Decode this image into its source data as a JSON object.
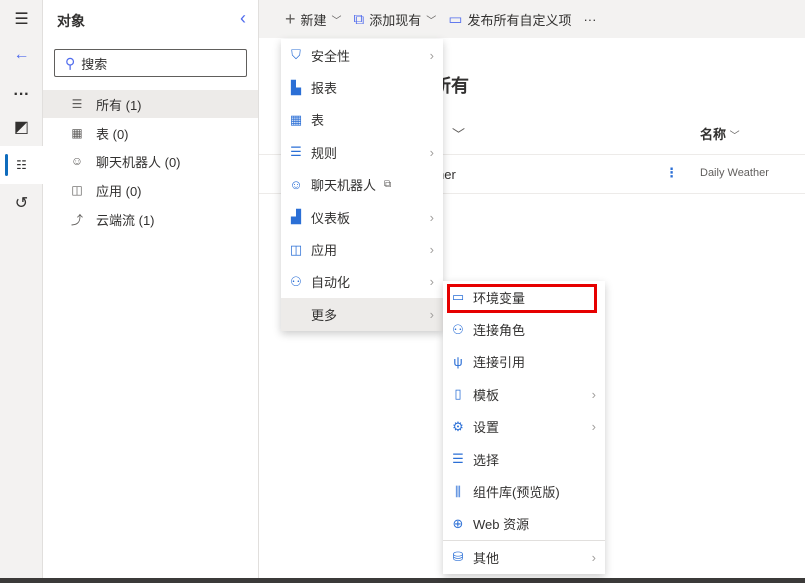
{
  "rail": {
    "icons": [
      "hamburger-icon",
      "back-arrow-icon",
      "more-icon",
      "solution-icon",
      "objects-icon",
      "history-icon"
    ]
  },
  "panel": {
    "title": "对象",
    "search_placeholder": "搜索",
    "items": [
      {
        "label": "所有 (1)",
        "icon": "list-icon"
      },
      {
        "label": "表 (0)",
        "icon": "table-icon"
      },
      {
        "label": "聊天机器人 (0)",
        "icon": "bot-icon"
      },
      {
        "label": "应用 (0)",
        "icon": "app-icon"
      },
      {
        "label": "云端流 (1)",
        "icon": "flow-icon"
      }
    ]
  },
  "toolbar": {
    "new": "新建",
    "add_existing": "添加现有",
    "publish": "发布所有自定义项",
    "more": "···"
  },
  "main": {
    "title": "所有",
    "col_name": "名称",
    "row_partial": "her",
    "row_name": "Daily Weather"
  },
  "menu_new": [
    {
      "label": "安全性",
      "icon": "shield-icon",
      "sub": true
    },
    {
      "label": "报表",
      "icon": "report-icon"
    },
    {
      "label": "表",
      "icon": "table-icon"
    },
    {
      "label": "规则",
      "icon": "rules-icon",
      "sub": true
    },
    {
      "label": "聊天机器人",
      "icon": "bot-icon",
      "external": true
    },
    {
      "label": "仪表板",
      "icon": "dashboard-icon",
      "sub": true
    },
    {
      "label": "应用",
      "icon": "app-icon",
      "sub": true
    },
    {
      "label": "自动化",
      "icon": "automation-icon",
      "sub": true
    },
    {
      "label": "更多",
      "sub": true,
      "highlighted": true
    }
  ],
  "menu_more": [
    {
      "label": "环境变量",
      "icon": "env-var-icon",
      "highlighted_box": "#e60000"
    },
    {
      "label": "连接角色",
      "icon": "people-icon"
    },
    {
      "label": "连接引用",
      "icon": "plug-icon"
    },
    {
      "label": "模板",
      "icon": "template-icon",
      "sub": true
    },
    {
      "label": "设置",
      "icon": "settings-icon",
      "sub": true
    },
    {
      "label": "选择",
      "icon": "choice-icon"
    },
    {
      "label": "组件库(预览版)",
      "icon": "library-icon"
    },
    {
      "label": "Web 资源",
      "icon": "web-resource-icon"
    },
    {
      "label": "其他",
      "icon": "database-icon",
      "sub": true
    }
  ],
  "colors": {
    "accent": "#2b6fd6",
    "highlight_box": "#e60000"
  }
}
